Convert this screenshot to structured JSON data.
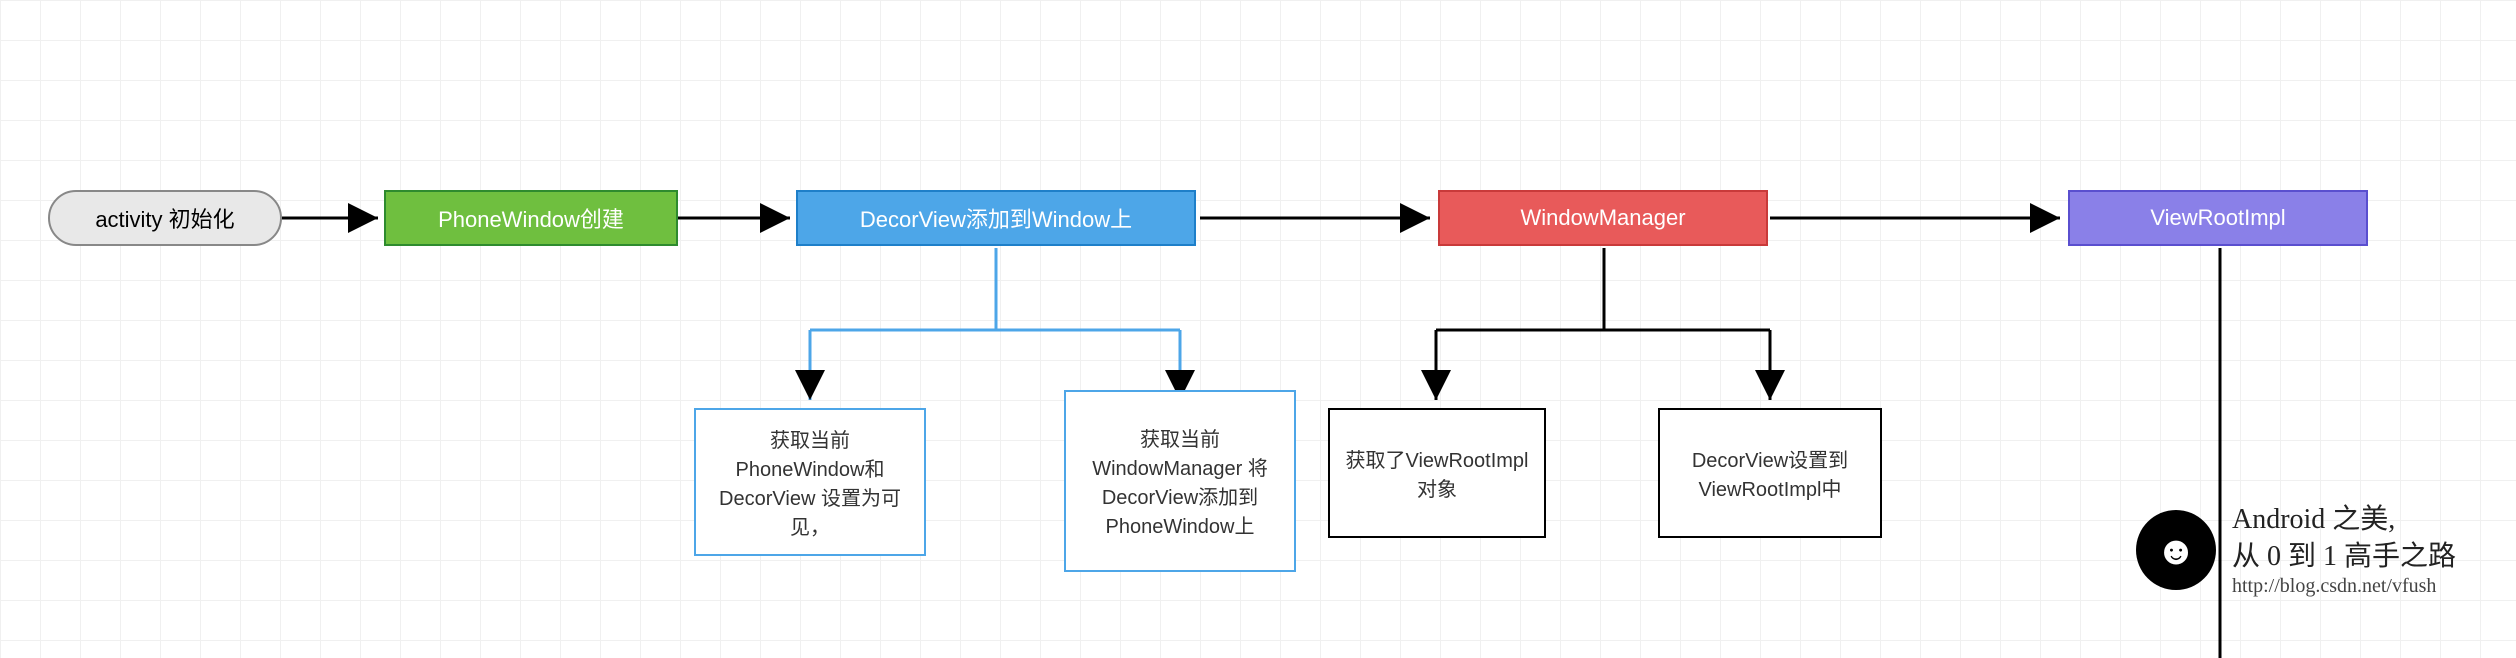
{
  "nodes": {
    "start": "activity 初始化",
    "phonewindow": "PhoneWindow创建",
    "decorview": "DecorView添加到Window上",
    "windowmanager": "WindowManager",
    "viewrootimpl": "ViewRootImpl"
  },
  "subs": {
    "decor1": "获取当前PhoneWindow和DecorView 设置为可见，",
    "decor2": "获取当前WindowManager 将DecorView添加到PhoneWindow上",
    "wm1": "获取了ViewRootImpl对象",
    "wm2": "DecorView设置到ViewRootImpl中"
  },
  "watermark": {
    "line1": "Android 之美,",
    "line2": "从 0 到 1 高手之路",
    "url": "http://blog.csdn.net/vfush"
  }
}
